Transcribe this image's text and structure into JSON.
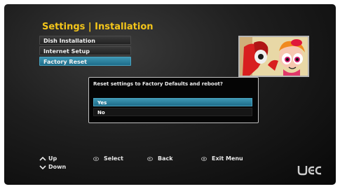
{
  "header": {
    "title": "Settings | Installation"
  },
  "menu": {
    "items": [
      {
        "label": "Dish Installation"
      },
      {
        "label": "Internet Setup"
      },
      {
        "label": "Factory Reset"
      }
    ]
  },
  "dialog": {
    "question": "Reset settings to Factory Defaults and reboot?",
    "options": [
      {
        "label": "Yes"
      },
      {
        "label": "No"
      }
    ]
  },
  "footer": {
    "up_label": "Up",
    "down_label": "Down",
    "select_label": "Select",
    "back_label": "Back",
    "exit_label": "Exit Menu"
  },
  "brand": {
    "logo_text": "UEC"
  },
  "colors": {
    "title": "#f3c51a",
    "highlight": "#2b83a3"
  }
}
